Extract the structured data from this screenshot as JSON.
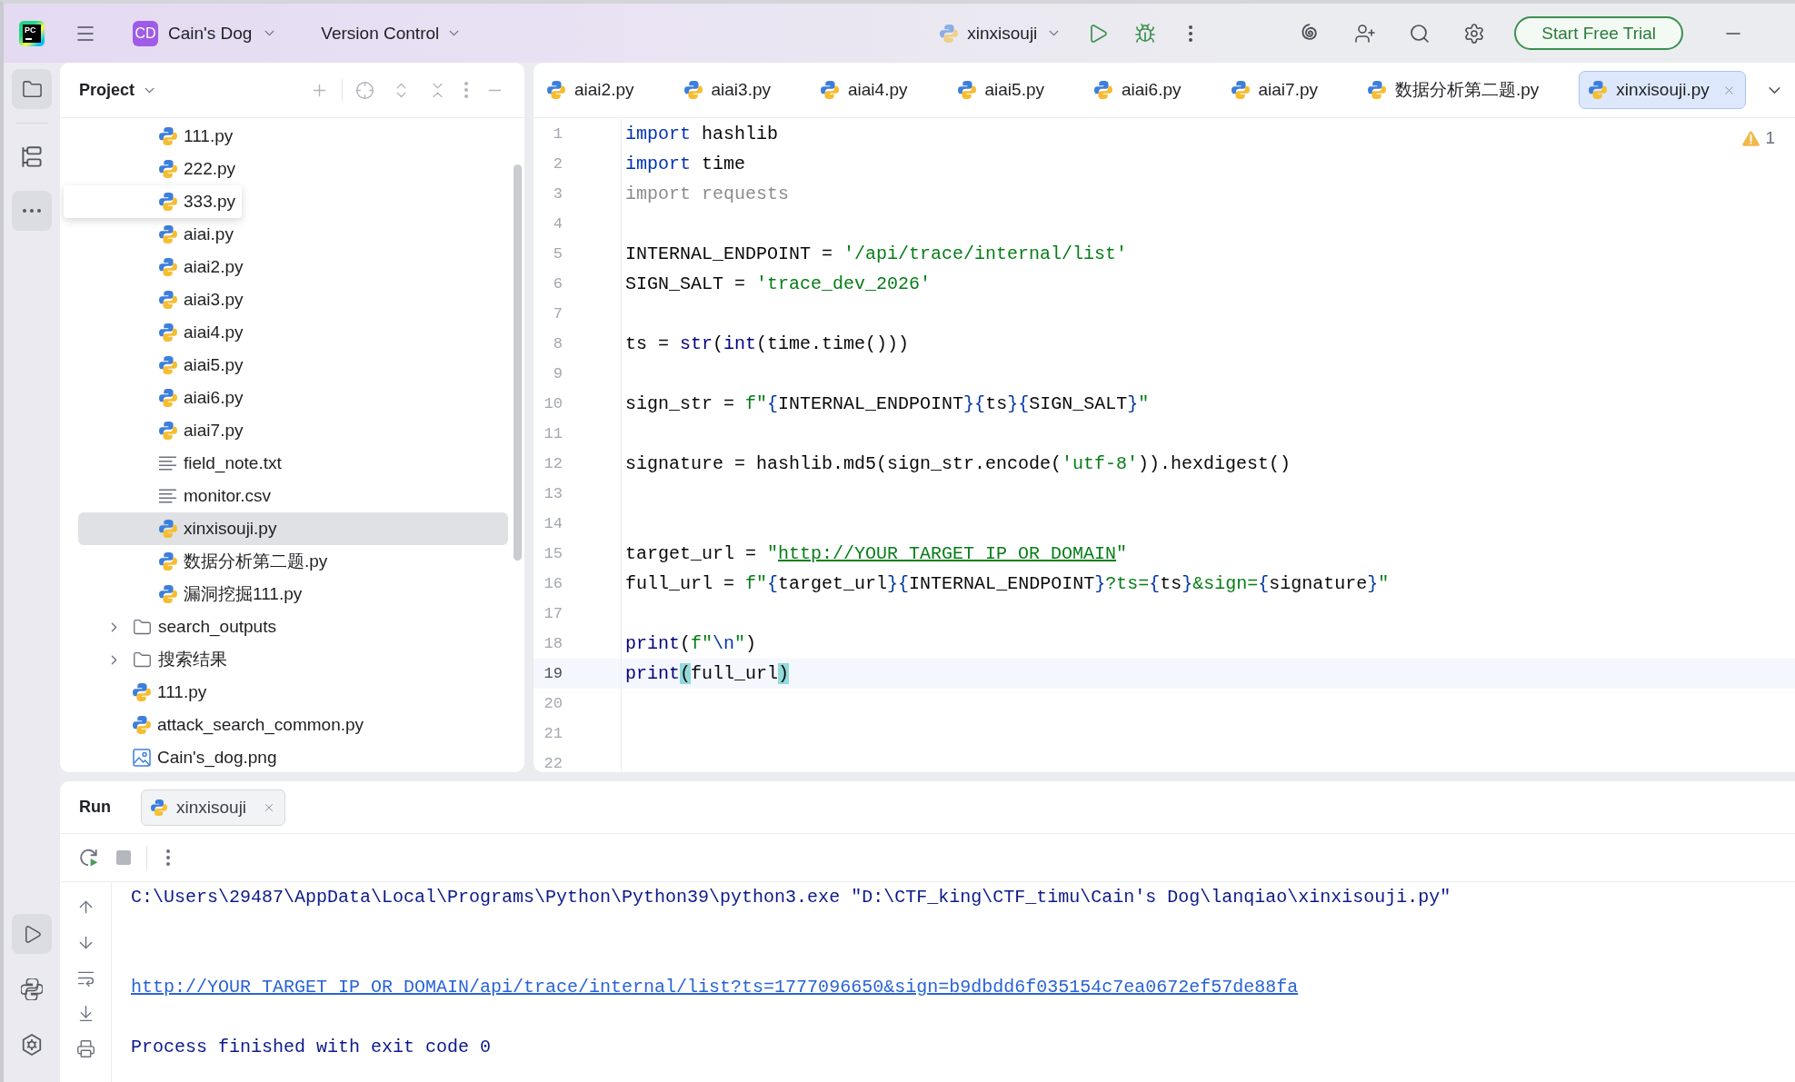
{
  "title_bar": {
    "app_logo": "PC",
    "project": {
      "initials": "CD",
      "name": "Cain's Dog"
    },
    "vcs_menu": "Version Control",
    "run_configuration": "xinxisouji",
    "trial_button": "Start Free Trial"
  },
  "tool_strip": {
    "top": [
      {
        "kind": "project",
        "selected": true
      },
      {
        "kind": "structure",
        "selected": false
      },
      {
        "kind": "more",
        "selected": true
      }
    ],
    "bottom": [
      {
        "kind": "run",
        "selected": true
      },
      {
        "kind": "python_console",
        "selected": false
      },
      {
        "kind": "services",
        "selected": false
      }
    ]
  },
  "project_panel": {
    "title": "Project",
    "tree": [
      {
        "children": [
          {
            "name": "111.py",
            "kind": "python",
            "selected": false,
            "hovered": false
          },
          {
            "name": "222.py",
            "kind": "python",
            "selected": false,
            "hovered": false
          },
          {
            "name": "333.py",
            "kind": "python",
            "selected": false,
            "hovered": true
          },
          {
            "name": "aiai.py",
            "kind": "python",
            "selected": false,
            "hovered": false
          },
          {
            "name": "aiai2.py",
            "kind": "python",
            "selected": false,
            "hovered": false
          },
          {
            "name": "aiai3.py",
            "kind": "python",
            "selected": false,
            "hovered": false
          },
          {
            "name": "aiai4.py",
            "kind": "python",
            "selected": false,
            "hovered": false
          },
          {
            "name": "aiai5.py",
            "kind": "python",
            "selected": false,
            "hovered": false
          },
          {
            "name": "aiai6.py",
            "kind": "python",
            "selected": false,
            "hovered": false
          },
          {
            "name": "aiai7.py",
            "kind": "python",
            "selected": false,
            "hovered": false
          },
          {
            "name": "field_note.txt",
            "kind": "text",
            "selected": false,
            "hovered": false
          },
          {
            "name": "monitor.csv",
            "kind": "text",
            "selected": false,
            "hovered": false
          },
          {
            "name": "xinxisouji.py",
            "kind": "python",
            "selected": true,
            "hovered": false
          },
          {
            "name": "数据分析第二题.py",
            "kind": "python",
            "selected": false,
            "hovered": false
          },
          {
            "name": "漏洞挖掘111.py",
            "kind": "python",
            "selected": false,
            "hovered": false
          }
        ]
      },
      {
        "name": "search_outputs",
        "kind": "folder",
        "expanded": false,
        "selected": false,
        "hovered": false
      },
      {
        "name": "搜索结果",
        "kind": "folder",
        "expanded": false,
        "selected": false,
        "hovered": false
      },
      {
        "name": "111.py",
        "kind": "python",
        "selected": false,
        "hovered": false
      },
      {
        "name": "attack_search_common.py",
        "kind": "python",
        "selected": false,
        "hovered": false
      },
      {
        "name": "Cain's_dog.png",
        "kind": "image",
        "selected": false,
        "hovered": false
      }
    ]
  },
  "editor": {
    "tabs": [
      {
        "name": "aiai2.py",
        "selected": false
      },
      {
        "name": "aiai3.py",
        "selected": false
      },
      {
        "name": "aiai4.py",
        "selected": false
      },
      {
        "name": "aiai5.py",
        "selected": false
      },
      {
        "name": "aiai6.py",
        "selected": false
      },
      {
        "name": "aiai7.py",
        "selected": false
      },
      {
        "name": "数据分析第二题.py",
        "selected": false
      },
      {
        "name": "xinxisouji.py",
        "selected": true
      }
    ],
    "warnings": "1",
    "lines": [
      {
        "number": "1",
        "current": false,
        "tokens": [
          {
            "kind": "keyword",
            "text": "import"
          },
          {
            "kind": "plain",
            "text": " hashlib"
          }
        ]
      },
      {
        "number": "2",
        "current": false,
        "tokens": [
          {
            "kind": "keyword",
            "text": "import"
          },
          {
            "kind": "plain",
            "text": " time"
          }
        ]
      },
      {
        "number": "3",
        "current": false,
        "tokens": [
          {
            "kind": "unused",
            "text": "import requests"
          }
        ]
      },
      {
        "number": "4",
        "current": false
      },
      {
        "number": "5",
        "current": false,
        "tokens": [
          {
            "kind": "plain",
            "text": "INTERNAL_ENDPOINT = "
          },
          {
            "kind": "string",
            "text": "'/api/trace/internal/list'"
          }
        ]
      },
      {
        "number": "6",
        "current": false,
        "tokens": [
          {
            "kind": "plain",
            "text": "SIGN_SALT = "
          },
          {
            "kind": "string",
            "text": "'trace_dev_2026'"
          }
        ]
      },
      {
        "number": "7",
        "current": false
      },
      {
        "number": "8",
        "current": false,
        "tokens": [
          {
            "kind": "plain",
            "text": "ts = "
          },
          {
            "kind": "builtin",
            "text": "str"
          },
          {
            "kind": "plain",
            "text": "("
          },
          {
            "kind": "builtin",
            "text": "int"
          },
          {
            "kind": "plain",
            "text": "(time.time()))"
          }
        ]
      },
      {
        "number": "9",
        "current": false
      },
      {
        "number": "10",
        "current": false,
        "tokens": [
          {
            "kind": "plain",
            "text": "sign_str = "
          },
          {
            "kind": "string",
            "text": "f\""
          },
          {
            "kind": "brace",
            "text": "{"
          },
          {
            "kind": "plain",
            "text": "INTERNAL_ENDPOINT"
          },
          {
            "kind": "brace",
            "text": "}{"
          },
          {
            "kind": "plain",
            "text": "ts"
          },
          {
            "kind": "brace",
            "text": "}{"
          },
          {
            "kind": "plain",
            "text": "SIGN_SALT"
          },
          {
            "kind": "brace",
            "text": "}"
          },
          {
            "kind": "string",
            "text": "\""
          }
        ]
      },
      {
        "number": "11",
        "current": false
      },
      {
        "number": "12",
        "current": false,
        "tokens": [
          {
            "kind": "plain",
            "text": "signature = hashlib.md5(sign_str.encode("
          },
          {
            "kind": "string",
            "text": "'utf-8'"
          },
          {
            "kind": "plain",
            "text": ")).hexdigest()"
          }
        ]
      },
      {
        "number": "13",
        "current": false
      },
      {
        "number": "14",
        "current": false
      },
      {
        "number": "15",
        "current": false,
        "tokens": [
          {
            "kind": "plain",
            "text": "target_url = "
          },
          {
            "kind": "string",
            "text": "\""
          },
          {
            "kind": "link",
            "text": "http://YOUR_TARGET_IP_OR_DOMAIN"
          },
          {
            "kind": "string",
            "text": "\""
          }
        ]
      },
      {
        "number": "16",
        "current": false,
        "tokens": [
          {
            "kind": "plain",
            "text": "full_url = "
          },
          {
            "kind": "string",
            "text": "f\""
          },
          {
            "kind": "brace",
            "text": "{"
          },
          {
            "kind": "plain",
            "text": "target_url"
          },
          {
            "kind": "brace",
            "text": "}{"
          },
          {
            "kind": "plain",
            "text": "INTERNAL_ENDPOINT"
          },
          {
            "kind": "brace",
            "text": "}"
          },
          {
            "kind": "string",
            "text": "?ts="
          },
          {
            "kind": "brace",
            "text": "{"
          },
          {
            "kind": "plain",
            "text": "ts"
          },
          {
            "kind": "brace",
            "text": "}"
          },
          {
            "kind": "string",
            "text": "&sign="
          },
          {
            "kind": "brace",
            "text": "{"
          },
          {
            "kind": "plain",
            "text": "signature"
          },
          {
            "kind": "brace",
            "text": "}"
          },
          {
            "kind": "string",
            "text": "\""
          }
        ]
      },
      {
        "number": "17",
        "current": false
      },
      {
        "number": "18",
        "current": false,
        "tokens": [
          {
            "kind": "builtin",
            "text": "print"
          },
          {
            "kind": "plain",
            "text": "("
          },
          {
            "kind": "string",
            "text": "f\""
          },
          {
            "kind": "escape",
            "text": "\\n"
          },
          {
            "kind": "string",
            "text": "\""
          },
          {
            "kind": "plain",
            "text": ")"
          }
        ]
      },
      {
        "number": "19",
        "current": true,
        "tokens": [
          {
            "kind": "builtin",
            "text": "print"
          },
          {
            "kind": "match",
            "text": "("
          },
          {
            "kind": "plain",
            "text": "full_url"
          },
          {
            "kind": "match",
            "text": ")"
          }
        ]
      },
      {
        "number": "20",
        "current": false
      },
      {
        "number": "21",
        "current": false
      },
      {
        "number": "22",
        "current": false
      }
    ]
  },
  "run_panel": {
    "title": "Run",
    "tabs": [
      {
        "name": "xinxisouji",
        "selected": true
      }
    ],
    "console": [
      {
        "kind": "command",
        "text": "C:\\Users\\29487\\AppData\\Local\\Programs\\Python\\Python39\\python3.exe \"D:\\CTF_king\\CTF_timu\\Cain's Dog\\lanqiao\\xinxisouji.py\""
      },
      {
        "kind": "blank"
      },
      {
        "kind": "blank"
      },
      {
        "kind": "link",
        "text": "http://YOUR_TARGET_IP_OR_DOMAIN/api/trace/internal/list?ts=1777096650&sign=b9dbdd6f035154c7ea0672ef57de88fa"
      },
      {
        "kind": "blank"
      },
      {
        "kind": "exit",
        "text": "Process finished with exit code 0"
      }
    ]
  }
}
